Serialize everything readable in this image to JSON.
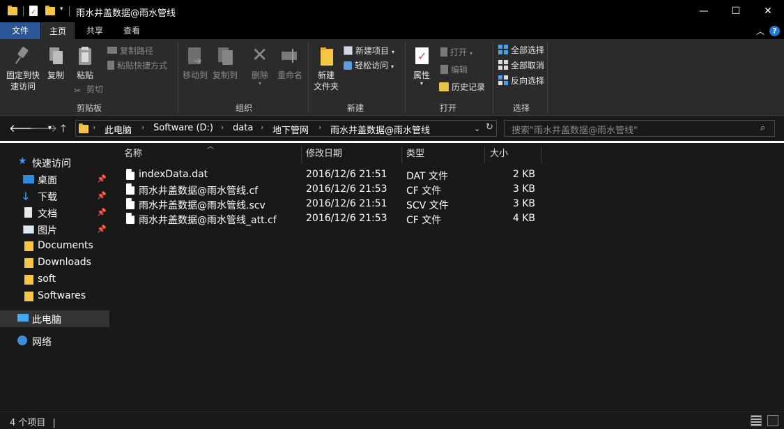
{
  "window": {
    "title": "雨水井盖数据@雨水管线",
    "controls": {
      "minimize": "—",
      "maximize": "☐",
      "close": "✕"
    }
  },
  "tabs": [
    {
      "label": "文件"
    },
    {
      "label": "主页"
    },
    {
      "label": "共享"
    },
    {
      "label": "查看"
    }
  ],
  "ribbon": {
    "clipboard": {
      "group_label": "剪贴板",
      "pin_label_1": "固定到快",
      "pin_label_2": "速访问",
      "copy_label": "复制",
      "paste_label": "粘贴",
      "copy_path_label": "复制路径",
      "paste_shortcut_label": "粘贴快捷方式",
      "cut_label": "剪切"
    },
    "organize": {
      "group_label": "组织",
      "move_to_label": "移动到",
      "copy_to_label": "复制到",
      "delete_label": "删除",
      "rename_label": "重命名"
    },
    "new": {
      "group_label": "新建",
      "new_folder_label_1": "新建",
      "new_folder_label_2": "文件夹",
      "new_item_label": "新建项目",
      "easy_access_label": "轻松访问"
    },
    "open": {
      "group_label": "打开",
      "properties_label": "属性",
      "open_label": "打开",
      "edit_label": "编辑",
      "history_label": "历史记录"
    },
    "select": {
      "group_label": "选择",
      "select_all_label": "全部选择",
      "select_none_label": "全部取消",
      "invert_label": "反向选择"
    }
  },
  "address": {
    "crumbs": [
      "此电脑",
      "Software (D:)",
      "data",
      "地下管网",
      "雨水井盖数据@雨水管线"
    ],
    "search_placeholder": "搜索\"雨水井盖数据@雨水管线\""
  },
  "sidebar": {
    "quick_access": "快速访问",
    "items": [
      {
        "label": "桌面",
        "pinned": true
      },
      {
        "label": "下载",
        "pinned": true
      },
      {
        "label": "文档",
        "pinned": true
      },
      {
        "label": "图片",
        "pinned": true
      },
      {
        "label": "Documents",
        "pinned": false
      },
      {
        "label": "Downloads",
        "pinned": false
      },
      {
        "label": "soft",
        "pinned": false
      },
      {
        "label": "Softwares",
        "pinned": false
      }
    ],
    "this_pc": "此电脑",
    "network": "网络"
  },
  "filelist": {
    "columns": {
      "name": "名称",
      "date": "修改日期",
      "type": "类型",
      "size": "大小"
    },
    "files": [
      {
        "name": "indexData.dat",
        "date": "2016/12/6 21:51",
        "type": "DAT 文件",
        "size": "2 KB"
      },
      {
        "name": "雨水井盖数据@雨水管线.cf",
        "date": "2016/12/6 21:53",
        "type": "CF 文件",
        "size": "3 KB"
      },
      {
        "name": "雨水井盖数据@雨水管线.scv",
        "date": "2016/12/6 21:51",
        "type": "SCV 文件",
        "size": "3 KB"
      },
      {
        "name": "雨水井盖数据@雨水管线_att.cf",
        "date": "2016/12/6 21:53",
        "type": "CF 文件",
        "size": "4 KB"
      }
    ]
  },
  "status": {
    "count_text": "4 个项目",
    "cursor": "|"
  },
  "colors": {
    "file_tab": "#2b579a",
    "ribbon_bg": "#2b2b2b",
    "window_bg": "#191919",
    "folder": "#f5c543",
    "quick_access_star": "#3b9cff"
  }
}
